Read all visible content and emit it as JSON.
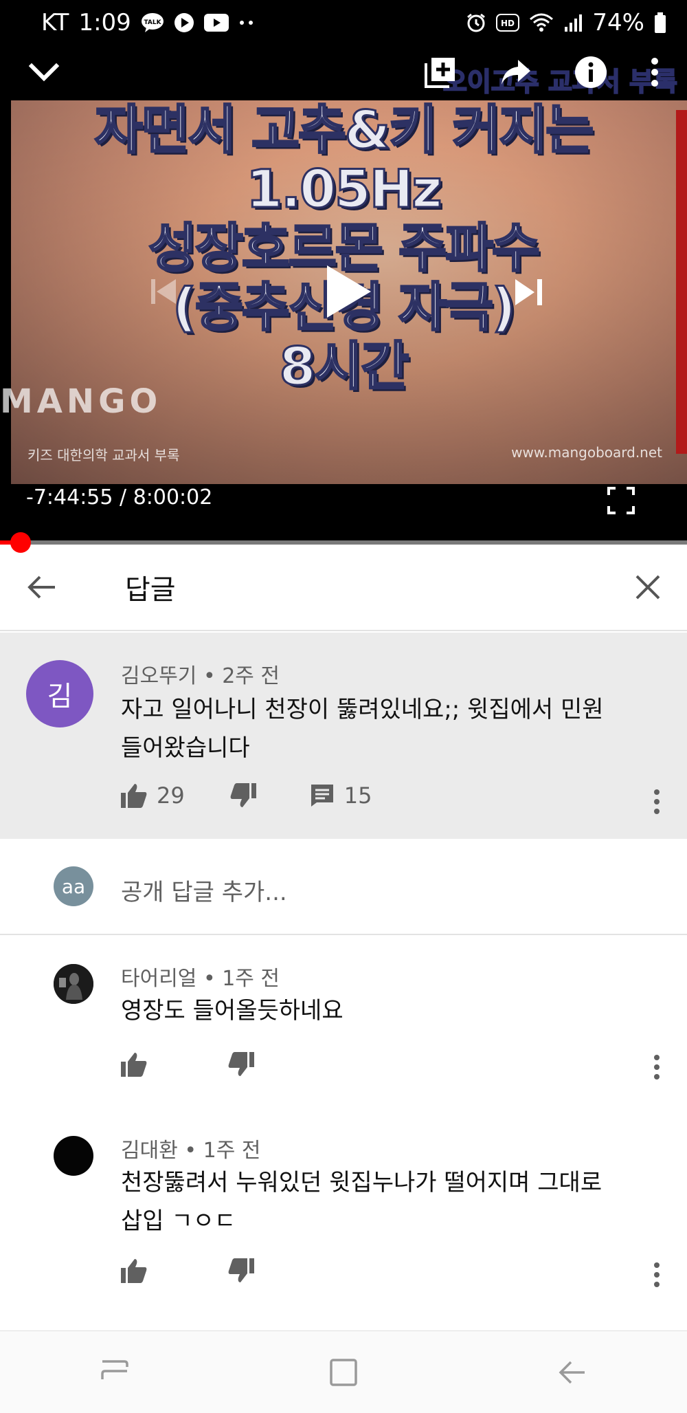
{
  "status_bar": {
    "carrier": "KT",
    "time": "1:09",
    "battery": "74%",
    "icons_left": [
      "talk-icon",
      "play-circle-icon",
      "youtube-icon",
      "more-dots-icon"
    ],
    "icons_right": [
      "alarm-icon",
      "hd-icon",
      "wifi-icon",
      "signal-icon",
      "battery-icon"
    ]
  },
  "player": {
    "thumbnail_banner": "오이고추 교과서 부록",
    "thumbnail_title_lines": [
      "자면서 고추&키 커지는",
      "1.05Hz",
      "성장호르몬 주파수",
      "(중추신경 자극)",
      "8시간"
    ],
    "thumbnail_brand": "MANGO",
    "thumbnail_footer_left": "키즈 대한의학 교과서 부록",
    "thumbnail_footer_right": "www.mangoboard.net",
    "remaining_time": "-7:44:55",
    "separator": "/",
    "duration": "8:00:02",
    "progress_fraction": 0.03,
    "colors": {
      "progress": "#ff0000"
    }
  },
  "replies_panel": {
    "title": "답글",
    "parent_comment": {
      "avatar_letter": "김",
      "avatar_color": "#7e57c2",
      "author": "김오뚜기",
      "age": "2주 전",
      "text_line1": "자고 일어나니 천장이 뚫려있네요;; 윗집에서 민원",
      "text_line2": "들어왔습니다",
      "likes": "29",
      "replies": "15"
    },
    "add_reply": {
      "avatar_text": "aa",
      "placeholder": "공개 답글 추가..."
    },
    "replies": [
      {
        "author": "타어리얼",
        "age": "1주 전",
        "text_line1": "영장도 들어올듯하네요",
        "text_line2": ""
      },
      {
        "author": "김대환",
        "age": "1주 전",
        "text_line1": "천장뚫려서 누워있던 윗집누나가 떨어지며 그대로",
        "text_line2": "삽입 ㄱㅇㄷ"
      }
    ],
    "separator": "•"
  }
}
